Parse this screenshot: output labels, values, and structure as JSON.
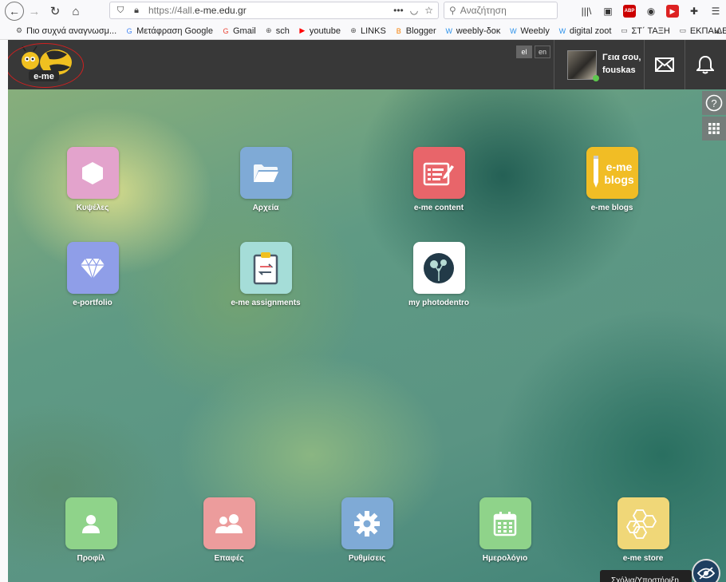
{
  "browser": {
    "url_prefix": "https://4all.",
    "url_domain": "e-me.edu.gr",
    "search_placeholder": "Αναζήτηση",
    "bookmarks": [
      {
        "label": "Πιο συχνά αναγνωσμ...",
        "icon": "gear-icon",
        "color": "#555555"
      },
      {
        "label": "Μετάφραση Google",
        "icon": "translate-icon",
        "color": "#4285f4"
      },
      {
        "label": "Gmail",
        "icon": "google-icon",
        "color": "#ea4335"
      },
      {
        "label": "sch",
        "icon": "globe-icon",
        "color": "#555555"
      },
      {
        "label": "youtube",
        "icon": "youtube-icon",
        "color": "#ff0000"
      },
      {
        "label": "LINKS",
        "icon": "globe-icon",
        "color": "#555555"
      },
      {
        "label": "Blogger",
        "icon": "blogger-icon",
        "color": "#f57d00"
      },
      {
        "label": "weebly-δοκ",
        "icon": "weebly-icon",
        "color": "#2990ea"
      },
      {
        "label": "Weebly",
        "icon": "weebly-icon",
        "color": "#2990ea"
      },
      {
        "label": "digital zoot",
        "icon": "weebly-icon",
        "color": "#2990ea"
      },
      {
        "label": "ΣΤ΄ ΤΑΞΗ",
        "icon": "folder-icon",
        "color": "#555555"
      },
      {
        "label": "ΕΚΠΑΙΔΕΥΣΗ",
        "icon": "folder-icon",
        "color": "#555555"
      }
    ]
  },
  "header": {
    "logo_text": "e-me",
    "lang_el": "el",
    "lang_en": "en",
    "greeting": "Γεια σου,",
    "username": "fouskas"
  },
  "apps": [
    {
      "label": "Κυψέλες",
      "icon": "hexagon-icon",
      "color": "#e3a3cc"
    },
    {
      "label": "Αρχεία",
      "icon": "folder-icon",
      "color": "#7faad6"
    },
    {
      "label": "e-me content",
      "icon": "content-editor-icon",
      "color": "#e8656a"
    },
    {
      "label": "e-me blogs",
      "icon": "blogs-icon",
      "color": "#f1bd25",
      "tile_text": "e-me blogs"
    },
    {
      "label": "e-portfolio",
      "icon": "diamond-icon",
      "color": "#8f9ee8"
    },
    {
      "label": "e-me assignments",
      "icon": "clipboard-icon",
      "color": "#a5ddd8"
    },
    {
      "label": "my photodentro",
      "icon": "photodentro-icon",
      "color": "#ffffff"
    }
  ],
  "dock": [
    {
      "label": "Προφίλ",
      "icon": "user-icon",
      "color": "#8fd38a"
    },
    {
      "label": "Επαφές",
      "icon": "contacts-icon",
      "color": "#ec9c9c"
    },
    {
      "label": "Ρυθμίσεις",
      "icon": "gear-icon",
      "color": "#7faad6"
    },
    {
      "label": "Ημερολόγιο",
      "icon": "calendar-icon",
      "color": "#8fd38a"
    },
    {
      "label": "e-me store",
      "icon": "store-icon",
      "color": "#f0d778"
    }
  ],
  "toast": {
    "text": "Σχόλια/Υποστήριξη"
  }
}
